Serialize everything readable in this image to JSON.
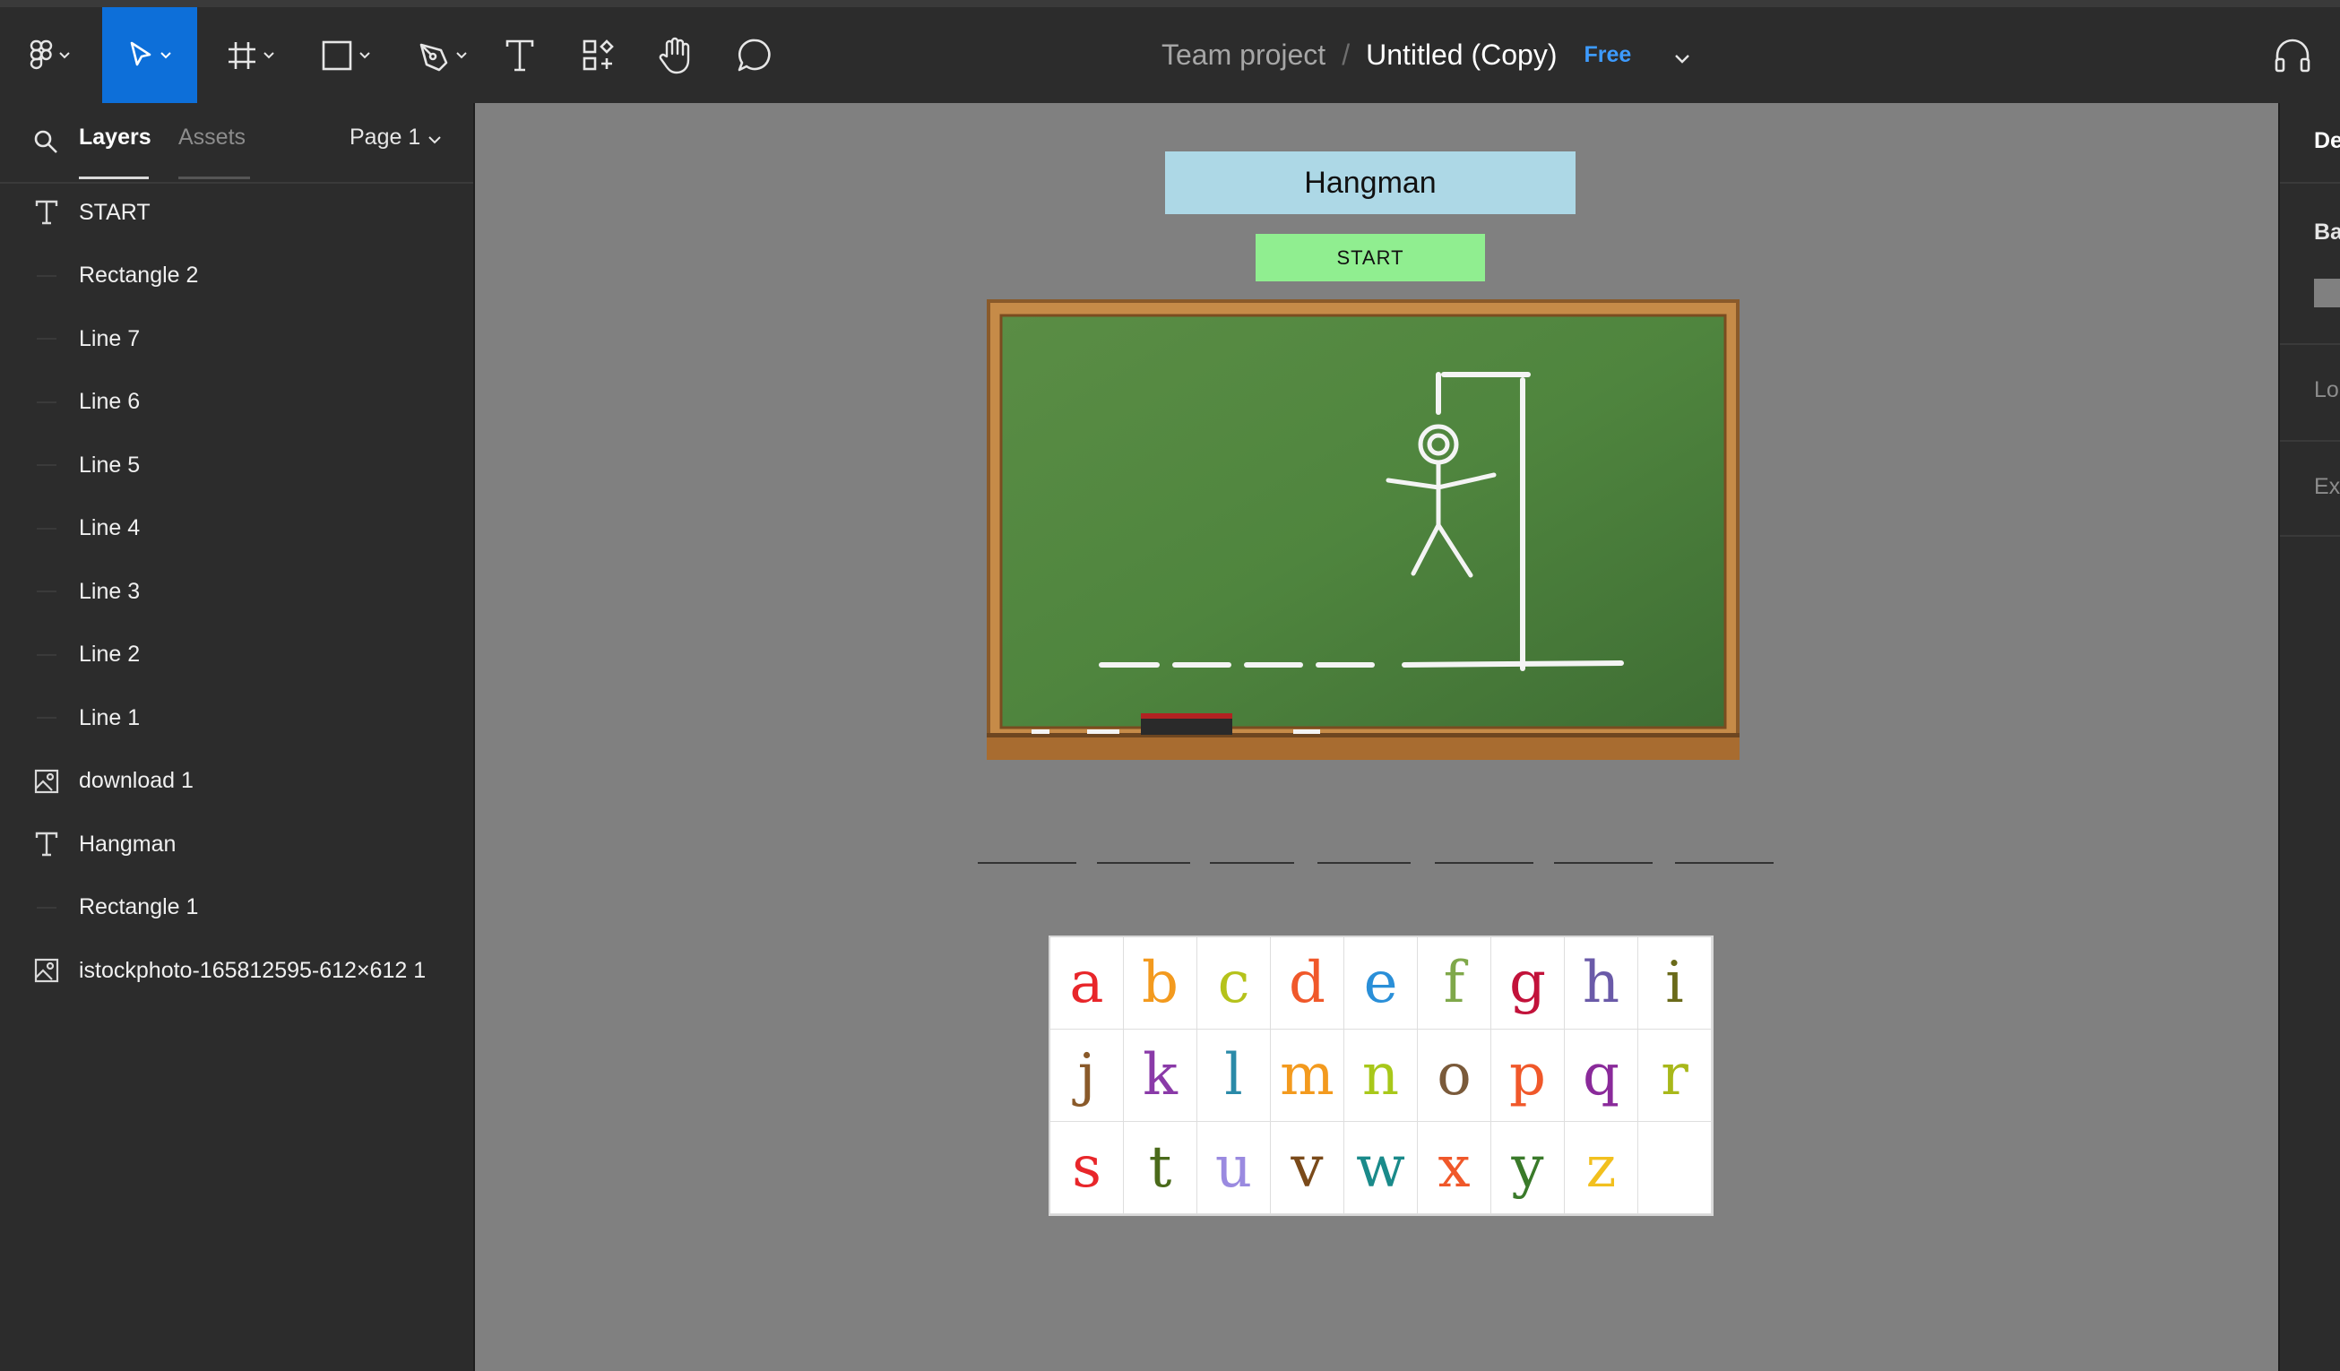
{
  "toolbar": {
    "project": "Team project",
    "separator": "/",
    "file_name": "Untitled (Copy)",
    "plan_badge": "Free",
    "tools": [
      "figma-menu-icon",
      "move-tool-icon",
      "frame-tool-icon",
      "shape-tool-icon",
      "pen-tool-icon",
      "text-tool-icon",
      "components-icon",
      "hand-tool-icon",
      "comment-icon",
      "headphones-icon"
    ],
    "accent_color": "#0d6fd9"
  },
  "left_panel": {
    "tabs": [
      "Layers",
      "Assets"
    ],
    "page_selector": "Page 1",
    "layers": [
      {
        "icon": "text",
        "name": "START"
      },
      {
        "icon": "line",
        "name": "Rectangle 2"
      },
      {
        "icon": "line",
        "name": "Line 7"
      },
      {
        "icon": "line",
        "name": "Line 6"
      },
      {
        "icon": "line",
        "name": "Line 5"
      },
      {
        "icon": "line",
        "name": "Line 4"
      },
      {
        "icon": "line",
        "name": "Line 3"
      },
      {
        "icon": "line",
        "name": "Line 2"
      },
      {
        "icon": "line",
        "name": "Line 1"
      },
      {
        "icon": "image",
        "name": "download 1"
      },
      {
        "icon": "text",
        "name": "Hangman"
      },
      {
        "icon": "line",
        "name": "Rectangle 1"
      },
      {
        "icon": "image",
        "name": "istockphoto-165812595-612×612 1"
      }
    ]
  },
  "canvas": {
    "title": "Hangman",
    "start_label": "START",
    "blank_count": 7,
    "letters": [
      {
        "ch": "a",
        "color": "#e8262a"
      },
      {
        "ch": "b",
        "color": "#f39a1e"
      },
      {
        "ch": "c",
        "color": "#b5c21b"
      },
      {
        "ch": "d",
        "color": "#f0582a"
      },
      {
        "ch": "e",
        "color": "#2a8fd8"
      },
      {
        "ch": "f",
        "color": "#7fa84a"
      },
      {
        "ch": "g",
        "color": "#c2123a"
      },
      {
        "ch": "h",
        "color": "#6a5aa8"
      },
      {
        "ch": "i",
        "color": "#6a6a1a"
      },
      {
        "ch": "j",
        "color": "#8a5a2a"
      },
      {
        "ch": "k",
        "color": "#8a3aa8"
      },
      {
        "ch": "l",
        "color": "#2a8aa8"
      },
      {
        "ch": "m",
        "color": "#f39a1e"
      },
      {
        "ch": "n",
        "color": "#a8c81a"
      },
      {
        "ch": "o",
        "color": "#7a5a3a"
      },
      {
        "ch": "p",
        "color": "#f0582a"
      },
      {
        "ch": "q",
        "color": "#8a2a9a"
      },
      {
        "ch": "r",
        "color": "#a8b81a"
      },
      {
        "ch": "s",
        "color": "#e8262a"
      },
      {
        "ch": "t",
        "color": "#4a6a1a"
      },
      {
        "ch": "u",
        "color": "#9a8ae0"
      },
      {
        "ch": "v",
        "color": "#7a4a1a"
      },
      {
        "ch": "w",
        "color": "#1a8a8a"
      },
      {
        "ch": "x",
        "color": "#f0582a"
      },
      {
        "ch": "y",
        "color": "#3a7a2a"
      },
      {
        "ch": "z",
        "color": "#f2c01e"
      },
      {
        "ch": "",
        "color": "#ffffff"
      }
    ]
  },
  "right_panel": {
    "items": [
      "De",
      "Ba",
      "Lo",
      "Ex"
    ]
  }
}
